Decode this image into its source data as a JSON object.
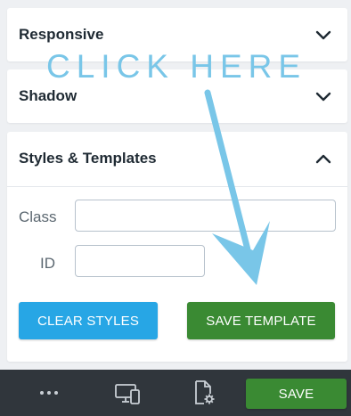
{
  "panels": {
    "responsive": {
      "title": "Responsive"
    },
    "shadow": {
      "title": "Shadow"
    },
    "styles": {
      "title": "Styles & Templates",
      "class_label": "Class",
      "class_value": "",
      "id_label": "ID",
      "id_value": "",
      "clear_label": "CLEAR STYLES",
      "save_template_label": "SAVE TEMPLATE"
    }
  },
  "bottombar": {
    "more_icon": "ellipsis-icon",
    "devices_icon": "responsive-devices-icon",
    "page_settings_icon": "page-settings-icon",
    "save_label": "SAVE"
  },
  "annotation": {
    "text": "CLICK HERE"
  },
  "colors": {
    "clear_button": "#27a6e5",
    "save_button": "#3a8a33",
    "annotation": "#79c6e8",
    "bottombar": "#30363c"
  }
}
